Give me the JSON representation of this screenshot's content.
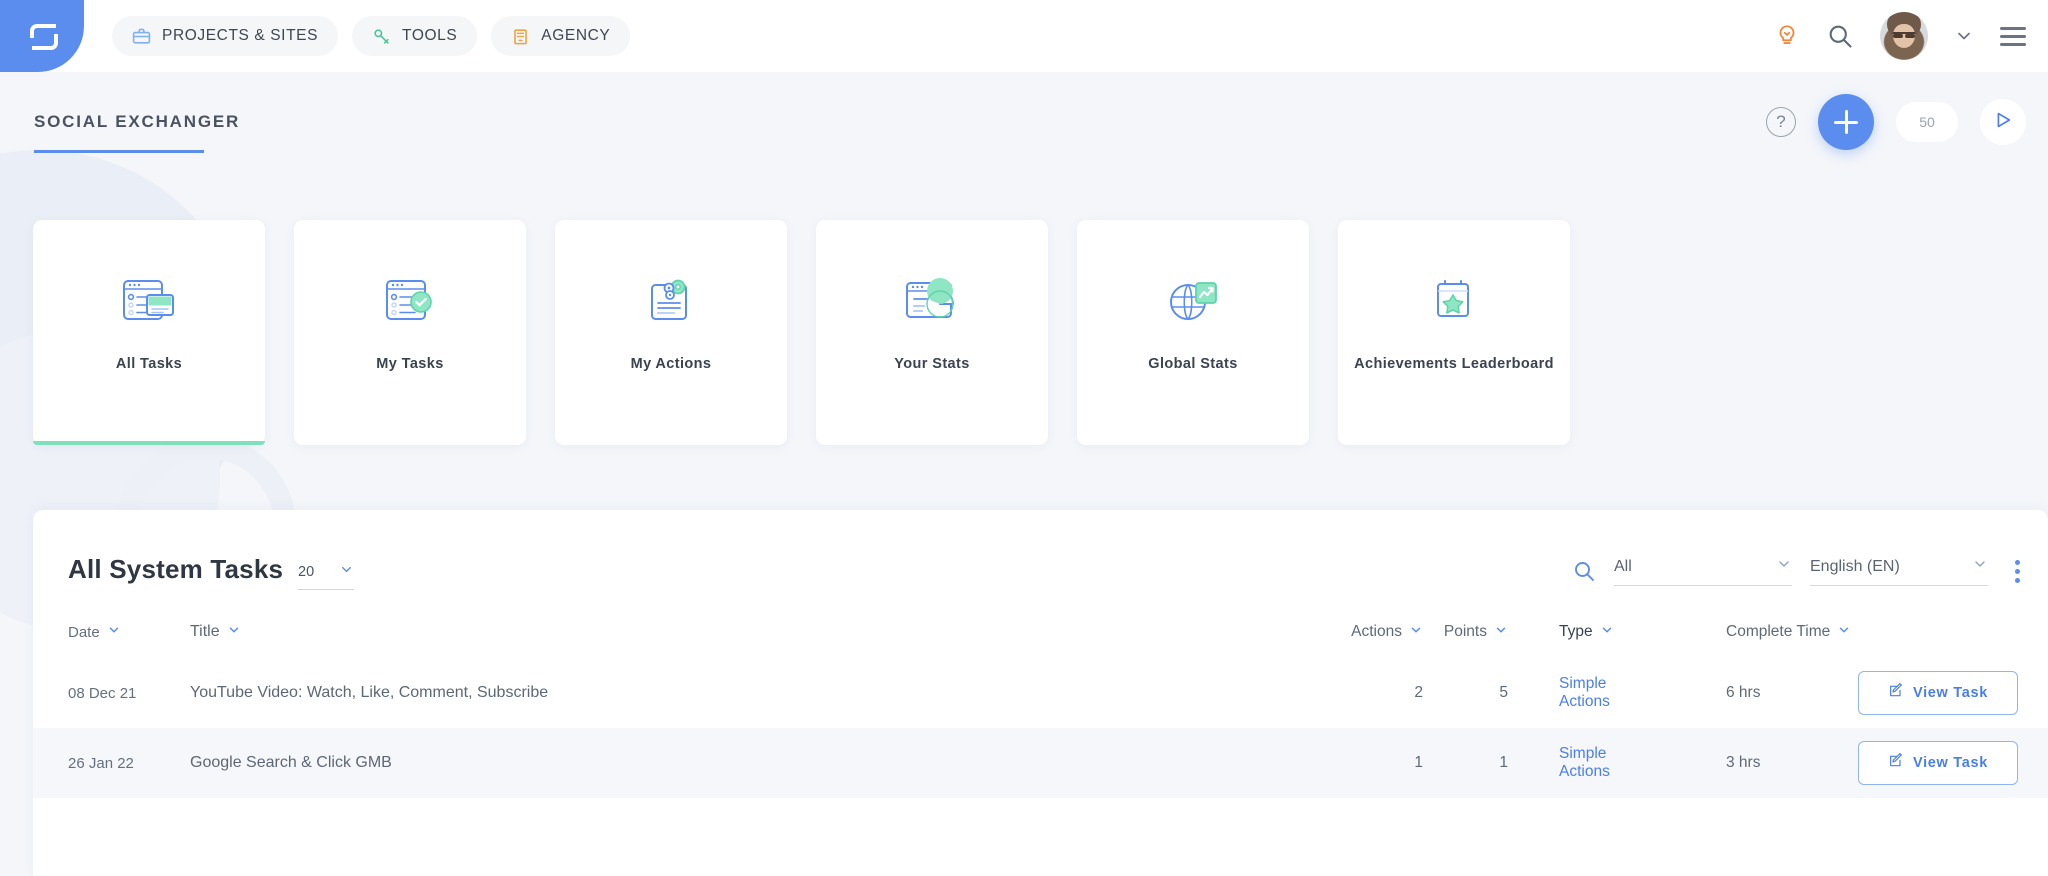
{
  "topbar": {
    "logo": "spotibo-logo",
    "nav": [
      {
        "label": "PROJECTS & SITES",
        "icon": "briefcase-icon",
        "color": "#7fb0f2"
      },
      {
        "label": "TOOLS",
        "icon": "wrench-icon",
        "color": "#4fc59a"
      },
      {
        "label": "AGENCY",
        "icon": "building-icon",
        "color": "#f0a243"
      }
    ],
    "right": {
      "idea_icon": "lightbulb-icon",
      "search_icon": "search-icon",
      "avatar": "user-avatar",
      "caret_icon": "chevron-down-icon",
      "menu_icon": "hamburger-menu-icon"
    }
  },
  "section": {
    "title": "SOCIAL EXCHANGER",
    "help_label": "?",
    "add_label": "+",
    "credits": "50",
    "play_icon": "play-icon",
    "accent": "#5b8def"
  },
  "cards": [
    {
      "label": "All Tasks",
      "icon": "all-tasks-icon",
      "active": true
    },
    {
      "label": "My Tasks",
      "icon": "my-tasks-icon",
      "active": false
    },
    {
      "label": "My Actions",
      "icon": "my-actions-icon",
      "active": false
    },
    {
      "label": "Your Stats",
      "icon": "your-stats-icon",
      "active": false
    },
    {
      "label": "Global Stats",
      "icon": "global-stats-icon",
      "active": false
    },
    {
      "label": "Achievements Leaderboard",
      "icon": "achievements-icon",
      "active": false
    }
  ],
  "panel": {
    "title": "All System Tasks",
    "per_page": "20",
    "search_icon": "search-icon",
    "filter_type": "All",
    "filter_language": "English (EN)",
    "kebab": "more-options-icon",
    "columns": [
      {
        "key": "date",
        "label": "Date"
      },
      {
        "key": "title",
        "label": "Title"
      },
      {
        "key": "actions",
        "label": "Actions"
      },
      {
        "key": "points",
        "label": "Points"
      },
      {
        "key": "type",
        "label": "Type"
      },
      {
        "key": "complete_time",
        "label": "Complete Time"
      }
    ],
    "view_task_label": "View Task",
    "view_task_icon": "edit-icon",
    "rows": [
      {
        "date": "08 Dec 21",
        "title": "YouTube Video: Watch, Like, Comment, Subscribe",
        "actions": "2",
        "points": "5",
        "type": "Simple Actions",
        "complete_time": "6 hrs"
      },
      {
        "date": "26 Jan 22",
        "title": "Google Search & Click GMB",
        "actions": "1",
        "points": "1",
        "type": "Simple Actions",
        "complete_time": "3 hrs"
      }
    ]
  },
  "colors": {
    "accent_blue": "#5b8def",
    "link_blue": "#4a7eea",
    "active_green": "#7fe0bc",
    "page_bg": "#f4f6fa"
  }
}
